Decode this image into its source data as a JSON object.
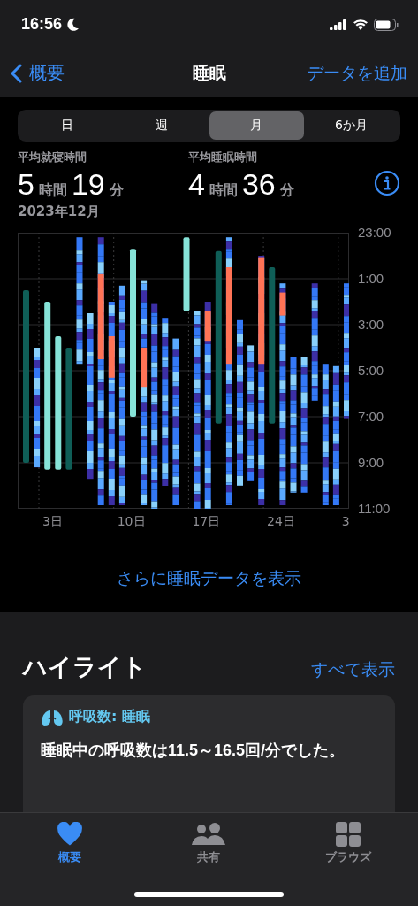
{
  "status_bar": {
    "time": "16:56"
  },
  "nav": {
    "back": "概要",
    "title": "睡眠",
    "action": "データを追加"
  },
  "segments": [
    {
      "label": "日",
      "selected": false
    },
    {
      "label": "週",
      "selected": false
    },
    {
      "label": "月",
      "selected": true
    },
    {
      "label": "6か月",
      "selected": false
    }
  ],
  "stats": [
    {
      "label": "平均就寝時間",
      "hours": "5",
      "hours_unit": "時間",
      "minutes": "19",
      "minutes_unit": "分"
    },
    {
      "label": "平均睡眠時間",
      "hours": "4",
      "hours_unit": "時間",
      "minutes": "36",
      "minutes_unit": "分"
    }
  ],
  "period": "2023年12月",
  "chart": {
    "y_labels": [
      "23:00",
      "1:00",
      "3:00",
      "5:00",
      "7:00",
      "9:00",
      "11:00"
    ],
    "x_labels": [
      "3日",
      "10日",
      "17日",
      "24日",
      "3"
    ]
  },
  "more_link": "さらに睡眠データを表示",
  "highlights": {
    "title": "ハイライト",
    "see_all": "すべて表示",
    "card": {
      "heading": "呼吸数: 睡眠",
      "body": "睡眠中の呼吸数は11.5～16.5回/分でした。"
    }
  },
  "tab_bar": [
    {
      "label": "概要",
      "selected": true
    },
    {
      "label": "共有",
      "selected": false
    },
    {
      "label": "ブラウズ",
      "selected": false
    }
  ]
}
